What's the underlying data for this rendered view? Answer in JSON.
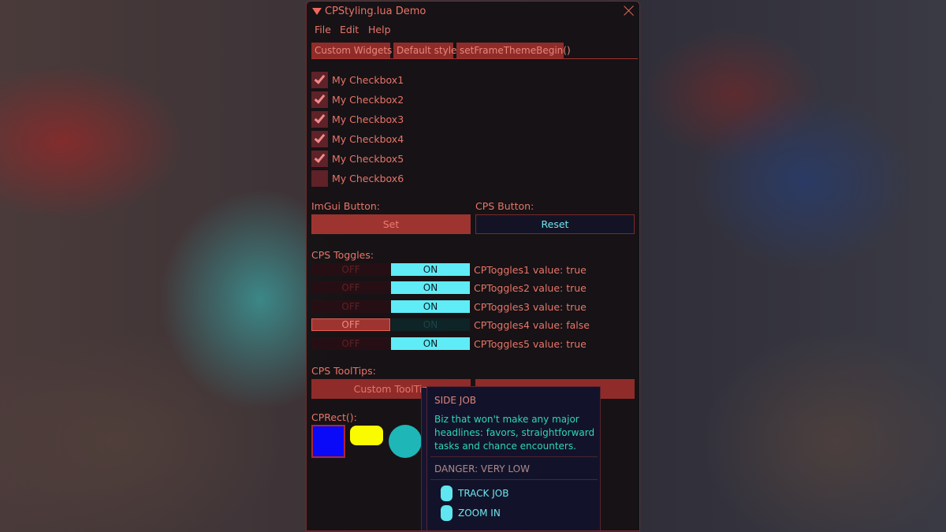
{
  "window": {
    "title": "CPStyling.lua Demo",
    "close_icon": "close-x-icon",
    "collapse_icon": "triangle-down-icon"
  },
  "menu": [
    "File",
    "Edit",
    "Help"
  ],
  "tabs": [
    "Custom Widgets",
    "Default style",
    "setFrameThemeBegin()"
  ],
  "active_tab": "Custom Widgets",
  "checkboxes": [
    {
      "label": "My Checkbox1",
      "checked": true
    },
    {
      "label": "My Checkbox2",
      "checked": true
    },
    {
      "label": "My Checkbox3",
      "checked": true
    },
    {
      "label": "My Checkbox4",
      "checked": true
    },
    {
      "label": "My Checkbox5",
      "checked": true
    },
    {
      "label": "My Checkbox6",
      "checked": false
    }
  ],
  "buttons": {
    "imgui_label": "ImGui Button:",
    "imgui_button": "Set",
    "cps_label": "CPS Button:",
    "cps_button": "Reset"
  },
  "toggles": {
    "label": "CPS Toggles:",
    "off_text": "OFF",
    "on_text": "ON",
    "items": [
      {
        "value_text": "CPToggles1 value: true",
        "value": true
      },
      {
        "value_text": "CPToggles2 value: true",
        "value": true
      },
      {
        "value_text": "CPToggles3 value: true",
        "value": true
      },
      {
        "value_text": "CPToggles4 value: false",
        "value": false
      },
      {
        "value_text": "CPToggles5 value: true",
        "value": true
      }
    ]
  },
  "tooltips": {
    "label": "CPS ToolTips:",
    "button1": "Custom ToolTip",
    "button2": ""
  },
  "rect": {
    "label": "CPRect():",
    "colors": {
      "blue": "#0a0af8",
      "yellow": "#fbfb00",
      "teal": "#1fb6b8",
      "border_red": "#b0262e"
    }
  },
  "tooltip_popup": {
    "title": "SIDE JOB",
    "body": "Biz that won't make any major headlines: favors, straightforward tasks and chance encounters.",
    "danger": "DANGER: VERY LOW",
    "actions": [
      "TRACK JOB",
      "ZOOM IN"
    ]
  },
  "colors": {
    "accent_red": "#9e3430",
    "text_red": "#e8756a",
    "accent_cyan": "#5fecf6",
    "tooltip_bg": "#12132a"
  }
}
